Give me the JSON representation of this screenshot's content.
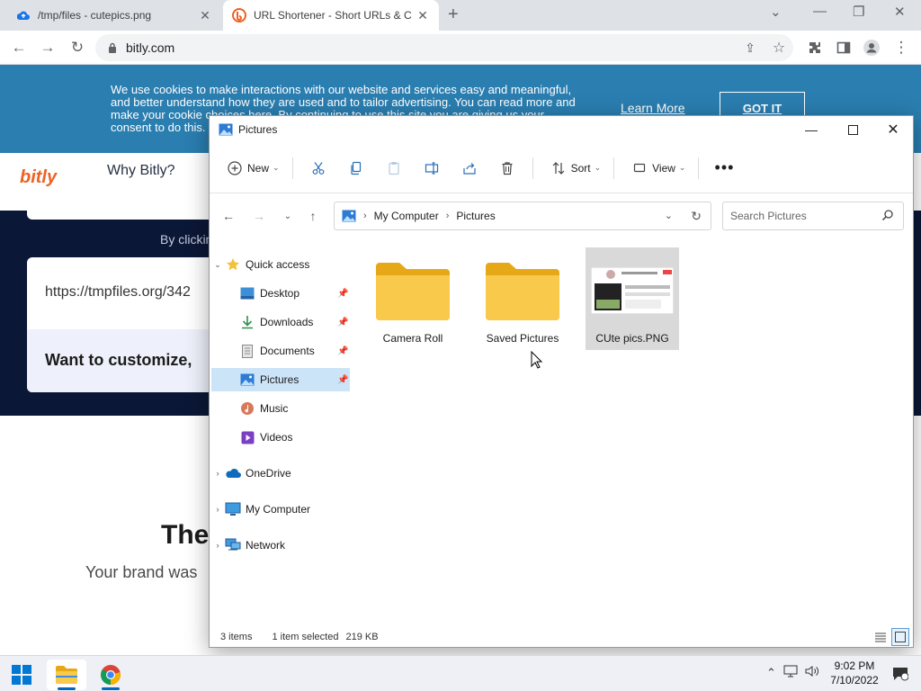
{
  "browser": {
    "tabs": [
      {
        "title": "/tmp/files - cutepics.png",
        "active": false
      },
      {
        "title": "URL Shortener - Short URLs & C",
        "active": true
      }
    ],
    "url": "bitly.com"
  },
  "bitly": {
    "cookie_text": "We use cookies to make interactions with our website and services easy and meaningful, and better understand how they are used and to tailor advertising. You can read more and make your cookie choices here. By continuing to use this site you are giving us your consent to do this.",
    "learn_more": "Learn More",
    "got_it": "GOT IT",
    "logo": "bitly",
    "nav_why": "Why Bitly?",
    "by_clicking": "By clickin",
    "url_input_value": "https://tmpfiles.org/342",
    "customize_text": "Want to customize,",
    "heading": "The",
    "brand_text": "Your brand was"
  },
  "explorer": {
    "title": "Pictures",
    "commands": {
      "new": "New",
      "sort": "Sort",
      "view": "View"
    },
    "address": {
      "root": "My Computer",
      "current": "Pictures"
    },
    "search_placeholder": "Search Pictures",
    "nav": {
      "quick_access": "Quick access",
      "desktop": "Desktop",
      "downloads": "Downloads",
      "documents": "Documents",
      "pictures": "Pictures",
      "music": "Music",
      "videos": "Videos",
      "onedrive": "OneDrive",
      "my_computer": "My Computer",
      "network": "Network"
    },
    "files": [
      {
        "name": "Camera Roll",
        "type": "folder"
      },
      {
        "name": "Saved Pictures",
        "type": "folder"
      },
      {
        "name": "CUte pics.PNG",
        "type": "image",
        "selected": true
      }
    ],
    "status": {
      "items": "3 items",
      "selected": "1 item selected",
      "size": "219 KB"
    }
  },
  "taskbar": {
    "time": "9:02 PM",
    "date": "7/10/2022"
  },
  "colors": {
    "cookie_banner": "#2a7eb0",
    "bitly_orange": "#ee6123",
    "hero_navy": "#0b1736",
    "selection": "#cce4f7",
    "folder_yellow": "#f8c94a"
  }
}
